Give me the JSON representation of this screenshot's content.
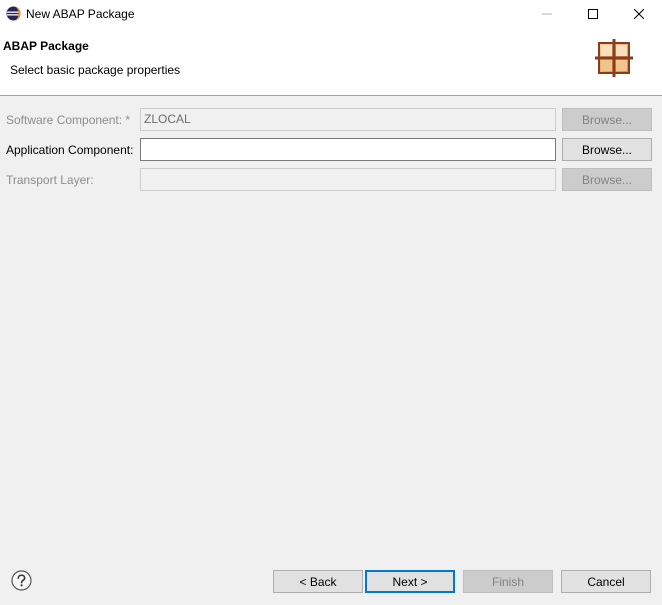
{
  "window": {
    "title": "New ABAP Package",
    "icons": {
      "app": "eclipse-icon",
      "minimize": "minimize-icon",
      "maximize": "maximize-icon",
      "close": "close-icon"
    }
  },
  "banner": {
    "title": "ABAP Package",
    "description": "Select basic package properties",
    "icon": "package-icon"
  },
  "form": {
    "software_component": {
      "label": "Software Component: *",
      "value": "ZLOCAL",
      "browse_label": "Browse...",
      "enabled": false
    },
    "application_component": {
      "label": "Application Component:",
      "value": "",
      "browse_label": "Browse...",
      "enabled": true
    },
    "transport_layer": {
      "label": "Transport Layer:",
      "value": "",
      "browse_label": "Browse...",
      "enabled": false
    }
  },
  "footer": {
    "help_icon": "help-icon",
    "back_label": "< Back",
    "next_label": "Next >",
    "finish_label": "Finish",
    "cancel_label": "Cancel"
  },
  "colors": {
    "dialog_bg": "#f0f0f0",
    "banner_bg": "#ffffff",
    "default_button_border": "#0078d7",
    "disabled_text": "#8c8c8c"
  }
}
